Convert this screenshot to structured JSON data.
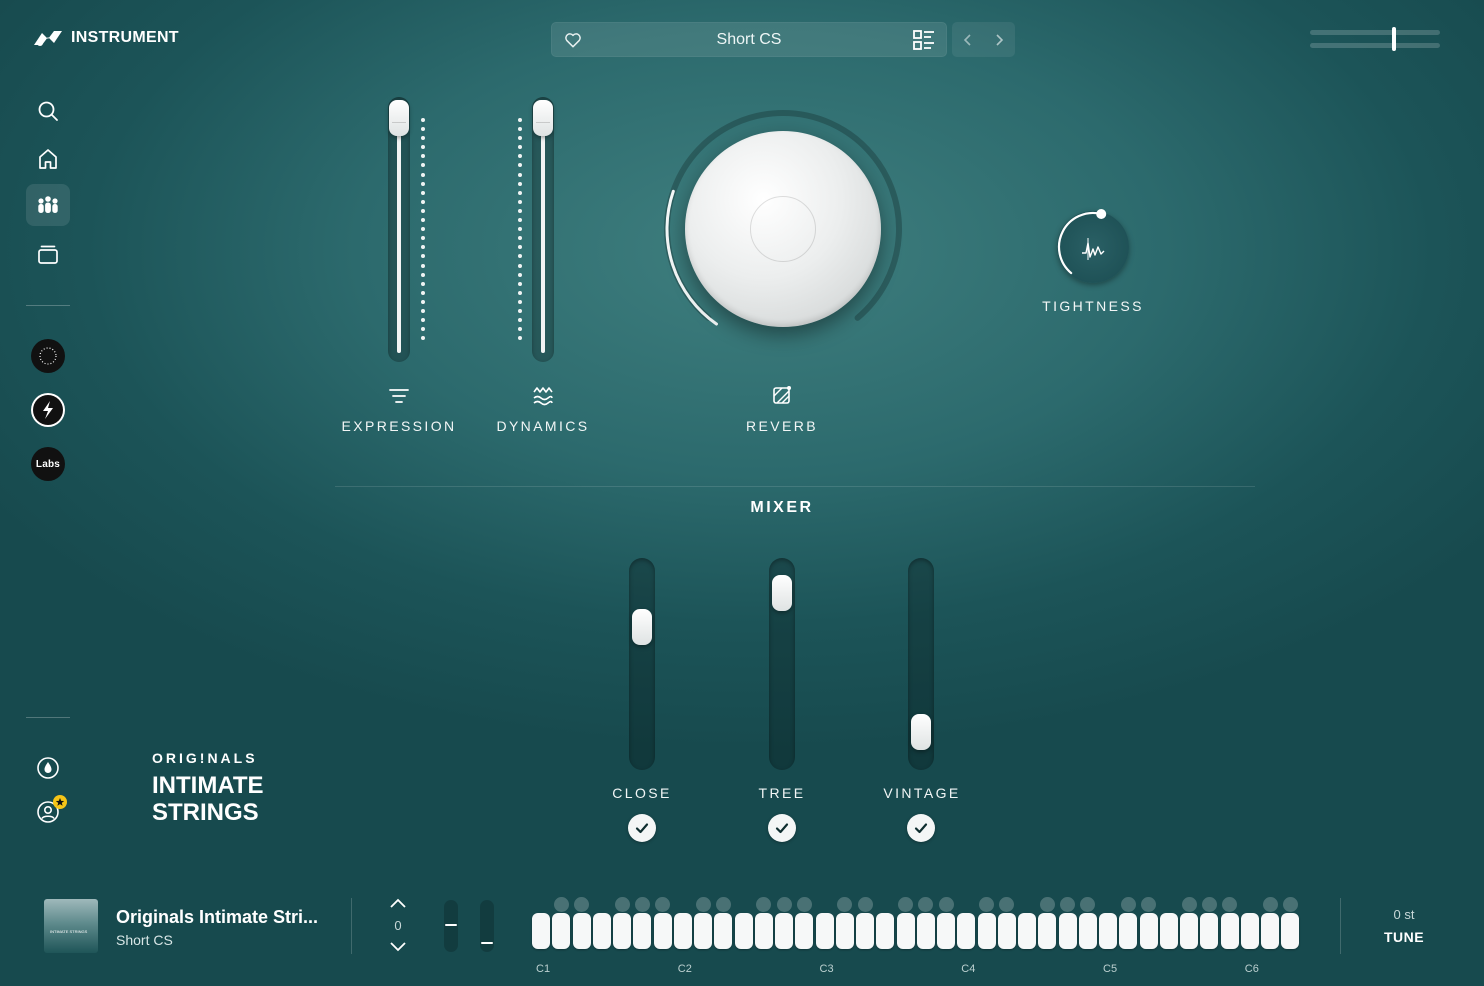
{
  "app": {
    "logo_text": "INSTRUMENT"
  },
  "header": {
    "preset_name": "Short CS",
    "icons": [
      "heart-icon",
      "list-view-icon",
      "chevron-left-icon",
      "chevron-right-icon"
    ],
    "master_volume_level": 0.65
  },
  "sidebar": {
    "top_icons": [
      "search-icon",
      "home-icon",
      "ensemble-icon",
      "layers-icon"
    ],
    "active": "ensemble-icon",
    "plugin_badges": [
      "spitfire-badge",
      "spitfire-s-badge",
      "labs-badge"
    ],
    "labs_text": "Labs",
    "bottom_icons": [
      "droplet-icon",
      "user-star-icon"
    ]
  },
  "controls": {
    "expression": {
      "label": "EXPRESSION",
      "value": 1.0,
      "icon": "filter-lines-icon"
    },
    "dynamics": {
      "label": "DYNAMICS",
      "value": 1.0,
      "icon": "waves-icon"
    },
    "reverb": {
      "label": "REVERB",
      "value": 0.3,
      "icon": "reverb-icon"
    },
    "tightness": {
      "label": "TIGHTNESS",
      "value": 0.55,
      "icon": "envelope-icon"
    }
  },
  "mixer": {
    "title": "MIXER",
    "channels": [
      {
        "label": "CLOSE",
        "value": 0.72,
        "enabled": true
      },
      {
        "label": "TREE",
        "value": 0.92,
        "enabled": true
      },
      {
        "label": "VINTAGE",
        "value": 0.1,
        "enabled": true
      }
    ]
  },
  "branding": {
    "sub": "ORIG!NALS",
    "title_line1": "INTIMATE",
    "title_line2": "STRINGS"
  },
  "footer": {
    "now_playing_title": "Originals Intimate Stri...",
    "now_playing_preset": "Short CS",
    "thumb_text": "INTIMATE STRINGS",
    "octave": "0",
    "octave_labels": [
      "C1",
      "C2",
      "C3",
      "C4",
      "C5",
      "C6"
    ],
    "tune_value": "0 st",
    "tune_label": "TUNE"
  },
  "colors": {
    "background": "#2c6a6d",
    "accent": "#ffffff"
  }
}
